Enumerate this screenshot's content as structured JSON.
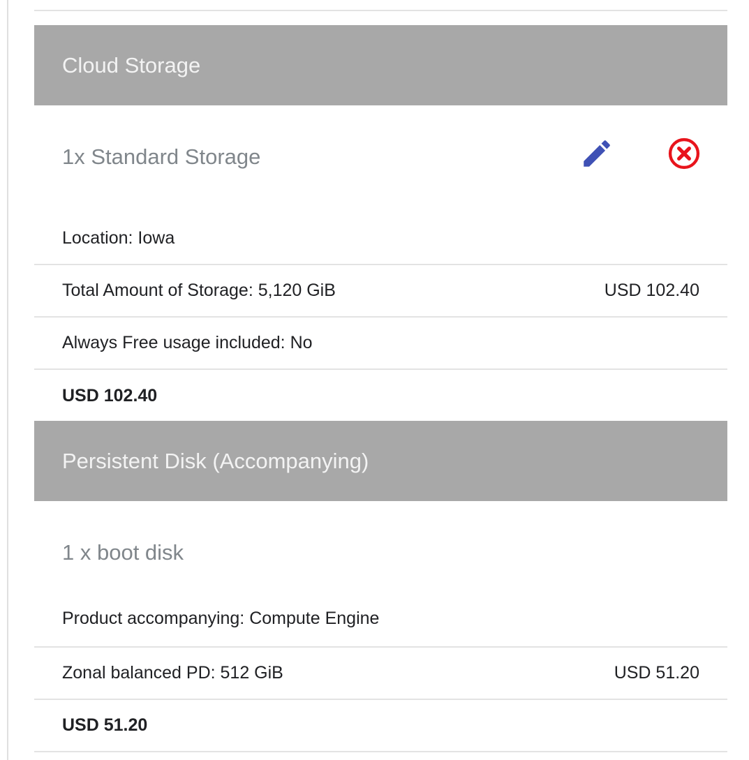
{
  "sections": [
    {
      "header": "Cloud Storage",
      "item_title": "1x Standard Storage",
      "has_actions": true,
      "rows": [
        {
          "label": "Location: Iowa",
          "price": ""
        },
        {
          "label": "Total Amount of Storage: 5,120 GiB",
          "price": "USD 102.40"
        },
        {
          "label": "Always Free usage included: No",
          "price": ""
        }
      ],
      "total": "USD 102.40"
    },
    {
      "header": "Persistent Disk (Accompanying)",
      "item_title": "1 x boot disk",
      "has_actions": false,
      "rows": [
        {
          "label": "Product accompanying: Compute Engine",
          "price": ""
        },
        {
          "label": "Zonal balanced PD: 512 GiB",
          "price": "USD 51.20"
        }
      ],
      "total": "USD 51.20"
    }
  ],
  "icons": {
    "edit": "pencil-icon",
    "remove": "close-circle-icon"
  },
  "colors": {
    "header_bg": "#a8a8a8",
    "header_text": "#f3f3f3",
    "item_title": "#80868b",
    "edit_icon": "#3f51b5",
    "remove_icon": "#e8141c"
  }
}
